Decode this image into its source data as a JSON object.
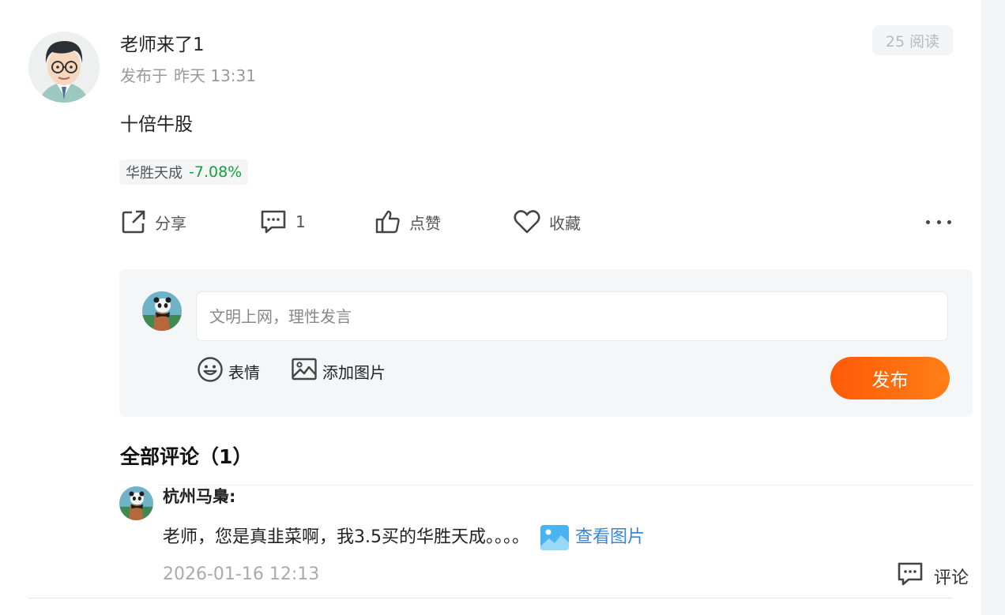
{
  "post": {
    "author": "老师来了1",
    "posted_prefix": "发布于",
    "posted_time": "昨天 13:31",
    "reads": "25 阅读",
    "content": "十倍牛股",
    "stock": {
      "name": "华胜天成",
      "change": "-7.08%",
      "change_color": "#12a43a"
    }
  },
  "actions": {
    "share_label": "分享",
    "comment_count": "1",
    "like_label": "点赞",
    "favorite_label": "收藏"
  },
  "compose": {
    "placeholder": "文明上网，理性发言",
    "emoji_label": "表情",
    "add_image_label": "添加图片",
    "publish_label": "发布",
    "publish_color": "#ff6a0a"
  },
  "comments": {
    "heading": "全部评论（1）",
    "items": [
      {
        "user": "杭州马梟:",
        "text": "老师，您是真韭菜啊，我3.5买的华胜天成。。。。",
        "view_image": "查看图片",
        "time": "2026-01-16 12:13",
        "reply_label": "评论"
      }
    ]
  },
  "icons": {
    "share": "share-icon",
    "comment": "comment-icon",
    "like": "thumbs-up-icon",
    "favorite": "heart-icon",
    "more": "more-dots-icon",
    "emoji": "emoji-icon",
    "image": "image-icon"
  }
}
